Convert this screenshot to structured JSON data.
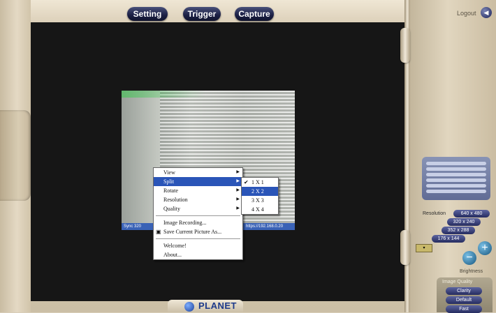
{
  "nav": {
    "setting": "Setting",
    "trigger": "Trigger",
    "capture": "Capture"
  },
  "logout": {
    "label": "Logout"
  },
  "camera": {
    "status_left": "Sync 320",
    "status_right": "https://192.168.0.20"
  },
  "context_menu": {
    "items": [
      {
        "label": "View",
        "submenu": true
      },
      {
        "label": "Split",
        "submenu": true,
        "selected": true
      },
      {
        "label": "Rotate",
        "submenu": true
      },
      {
        "label": "Resolution",
        "submenu": true
      },
      {
        "label": "Quality",
        "submenu": true
      }
    ],
    "actions": [
      "Image Recording...",
      "Save Current Picture As..."
    ],
    "info": [
      "Welcome!",
      "About..."
    ]
  },
  "split_submenu": {
    "items": [
      {
        "label": "1 X 1",
        "checked": true
      },
      {
        "label": "2 X 2",
        "selected": true
      },
      {
        "label": "3 X 3"
      },
      {
        "label": "4 X 4"
      }
    ]
  },
  "right_panel": {
    "resolution_label": "Resolution",
    "resolutions": [
      "640 x 480",
      "320 x 240",
      "352 x 288",
      "176 x 144"
    ],
    "brightness_label": "Brightness",
    "image_quality_label": "Image Quality",
    "quality_buttons": [
      "Clarity",
      "Default",
      "Fast"
    ]
  },
  "brand": {
    "name": "PLANET"
  }
}
